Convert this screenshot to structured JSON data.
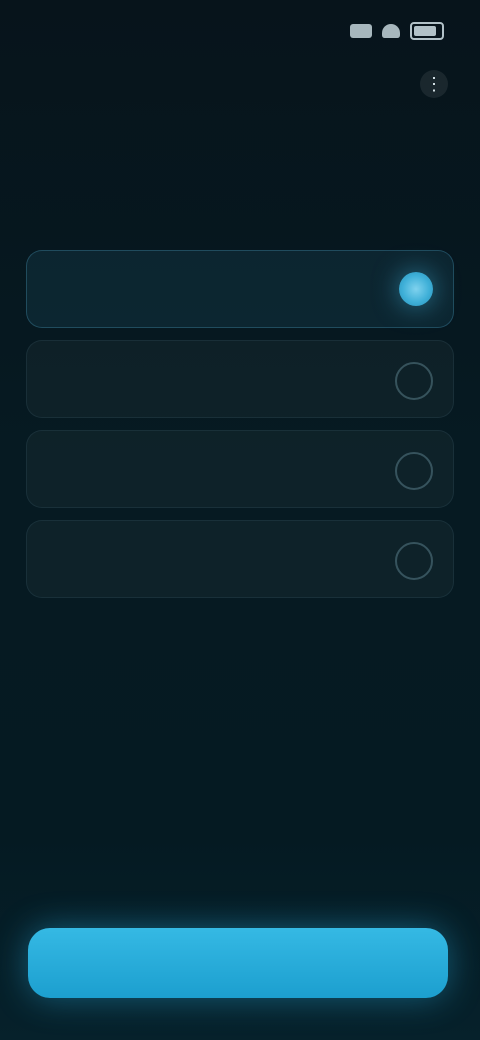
{
  "status_bar": {
    "time": "",
    "icons": [
      "signal-icon",
      "wifi-icon",
      "battery-icon"
    ]
  },
  "header": {
    "more_icon": "⋮"
  },
  "question": {
    "title": ""
  },
  "options": [
    {
      "label": "",
      "selected": true
    },
    {
      "label": "",
      "selected": false
    },
    {
      "label": "",
      "selected": false
    },
    {
      "label": "",
      "selected": false
    }
  ],
  "footer": {
    "continue_label": ""
  },
  "colors": {
    "accent": "#2aa9d8",
    "background": "#061a22"
  }
}
